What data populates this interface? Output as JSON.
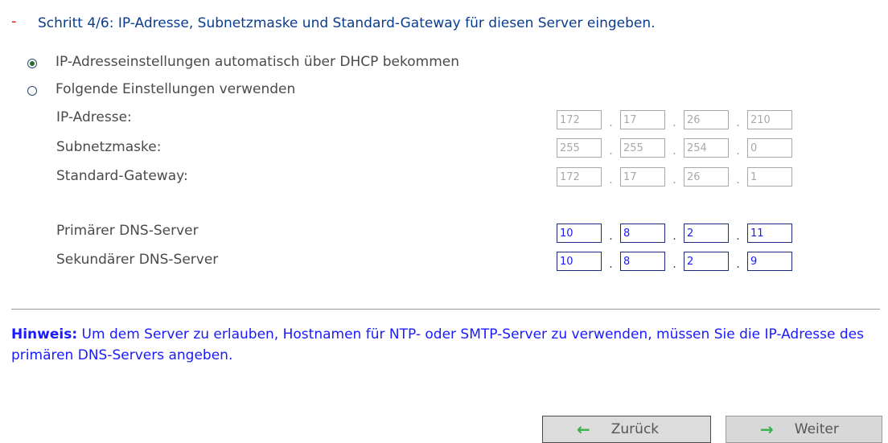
{
  "step": {
    "marker": "-",
    "text": "Schritt 4/6: IP-Adresse, Subnetzmaske und Standard-Gateway für diesen Server eingeben."
  },
  "radios": [
    {
      "label": "IP-Adresseinstellungen automatisch über DHCP bekommen",
      "selected": true
    },
    {
      "label": "Folgende Einstellungen verwenden",
      "selected": false
    }
  ],
  "fields": {
    "ip": {
      "label": "IP-Adresse:",
      "octets": [
        "172",
        "17",
        "26",
        "210"
      ],
      "enabled": false
    },
    "subnet": {
      "label": "Subnetzmaske:",
      "octets": [
        "255",
        "255",
        "254",
        "0"
      ],
      "enabled": false
    },
    "gateway": {
      "label": "Standard-Gateway:",
      "octets": [
        "172",
        "17",
        "26",
        "1"
      ],
      "enabled": false
    },
    "dns1": {
      "label": "Primärer DNS-Server",
      "octets": [
        "10",
        "8",
        "2",
        "11"
      ],
      "enabled": true
    },
    "dns2": {
      "label": "Sekundärer DNS-Server",
      "octets": [
        "10",
        "8",
        "2",
        "9"
      ],
      "enabled": true
    }
  },
  "separator": ".",
  "hint": {
    "bold": "Hinweis:",
    "text": " Um dem Server zu erlauben, Hostnamen für NTP- oder SMTP-Server zu verwenden, müssen Sie die IP-Adresse des primären DNS-Servers angeben."
  },
  "buttons": {
    "back": {
      "label": "Zurück",
      "icon": "arrow-left-icon",
      "arrow": "←"
    },
    "next": {
      "label": "Weiter",
      "icon": "arrow-right-icon",
      "arrow": "→"
    }
  },
  "colors": {
    "step_marker": "#e01010",
    "step_text": "#0a3d8f",
    "hint_text": "#1a1aff",
    "arrow": "#3ab04a"
  }
}
